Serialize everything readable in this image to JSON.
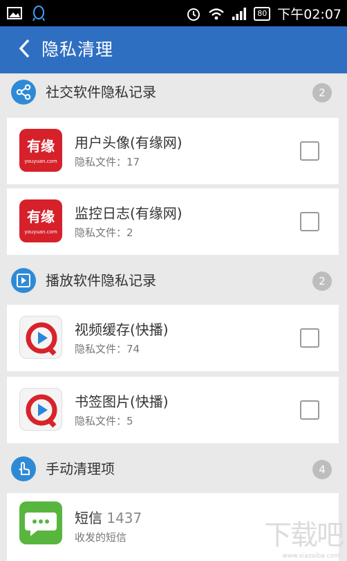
{
  "status_bar": {
    "time": "下午02:07",
    "battery": "80",
    "icons": [
      "image-icon",
      "qq-icon",
      "alarm-icon",
      "wifi-icon",
      "signal-icon",
      "battery-icon"
    ]
  },
  "header": {
    "title": "隐私清理",
    "back_icon": "back-chevron-icon"
  },
  "sections": [
    {
      "title": "社交软件隐私记录",
      "count": "2",
      "icon": "share-icon",
      "items": [
        {
          "name": "用户头像(有缘网)",
          "sub": "隐私文件：17",
          "logo_text": "有缘",
          "logo_sub": "youyuan.com"
        },
        {
          "name": "监控日志(有缘网)",
          "sub": "隐私文件：2",
          "logo_text": "有缘",
          "logo_sub": "youyuan.com"
        }
      ]
    },
    {
      "title": "播放软件隐私记录",
      "count": "2",
      "icon": "play-icon",
      "items": [
        {
          "name": "视频缓存(快播)",
          "sub": "隐私文件：74"
        },
        {
          "name": "书签图片(快播)",
          "sub": "隐私文件：5"
        }
      ]
    },
    {
      "title": "手动清理项",
      "count": "4",
      "icon": "hand-pointer-icon",
      "items": [
        {
          "name": "短信",
          "count": "1437",
          "sub": "收发的短信"
        }
      ]
    }
  ],
  "watermark": {
    "text": "下载吧",
    "url": "www.xiazaiba.com"
  },
  "colors": {
    "app_bar": "#2f6fc2",
    "section_icon": "#2f8ad6",
    "youyuan_red": "#d6212b",
    "sms_green": "#58b63f"
  }
}
